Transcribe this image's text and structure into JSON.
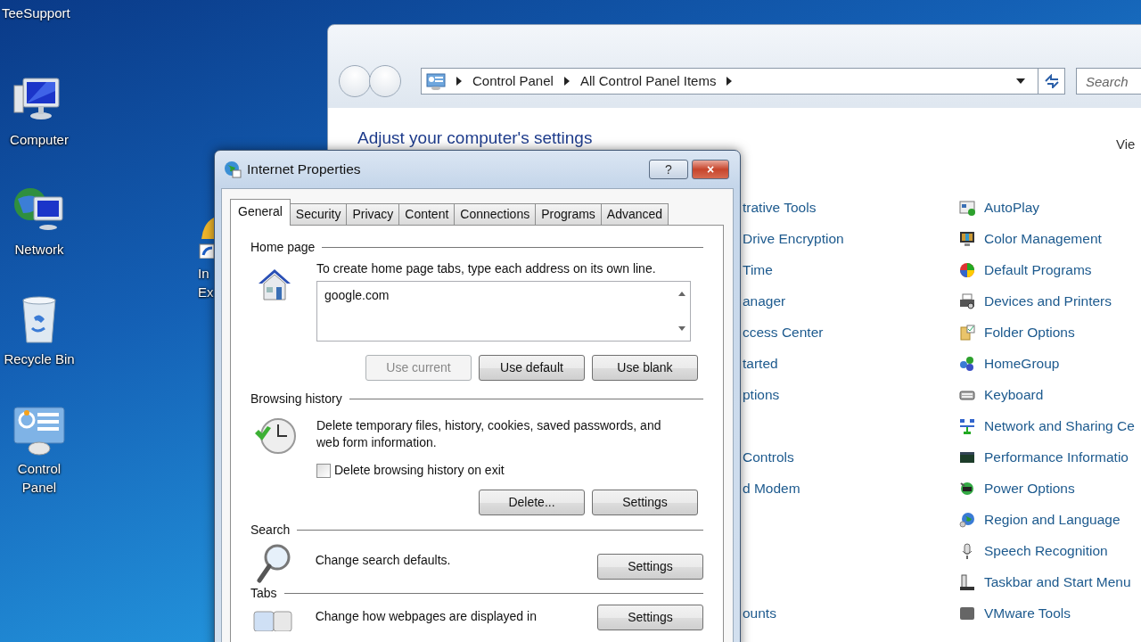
{
  "desktop": {
    "user_label": "TeeSupport",
    "icons": [
      {
        "label": "Computer"
      },
      {
        "label": "Network"
      },
      {
        "label": "Recycle Bin"
      },
      {
        "label": "Control Panel"
      }
    ],
    "partial_icon": {
      "label": "In Ex"
    }
  },
  "control_panel": {
    "breadcrumb": [
      "Control Panel",
      "All Control Panel Items"
    ],
    "search": {
      "placeholder": "Search"
    },
    "heading": "Adjust your computer's settings",
    "view_label": "Vie",
    "rows": [
      {
        "left": "trative Tools",
        "right": "AutoPlay"
      },
      {
        "left": "Drive Encryption",
        "right": "Color Management"
      },
      {
        "left": "Time",
        "right": "Default Programs"
      },
      {
        "left": "anager",
        "right": "Devices and Printers"
      },
      {
        "left": "ccess Center",
        "right": "Folder Options"
      },
      {
        "left": "tarted",
        "right": "HomeGroup"
      },
      {
        "left": "ptions",
        "right": "Keyboard"
      },
      {
        "right": "Network and Sharing Ce"
      },
      {
        "left": "Controls",
        "right": "Performance Informatio"
      },
      {
        "left": "d Modem",
        "right": "Power Options"
      },
      {
        "right": "Region and Language"
      },
      {
        "right": "Speech Recognition"
      },
      {
        "right": "Taskbar and Start Menu"
      },
      {
        "left": "ounts",
        "right": "VMware Tools"
      }
    ]
  },
  "dialog": {
    "title": "Internet Properties",
    "help": "?",
    "close": "×",
    "tabs": [
      {
        "label": "General",
        "selected": true
      },
      {
        "label": "Security",
        "selected": false
      },
      {
        "label": "Privacy",
        "selected": false
      },
      {
        "label": "Content",
        "selected": false
      },
      {
        "label": "Connections",
        "selected": false
      },
      {
        "label": "Programs",
        "selected": false
      },
      {
        "label": "Advanced",
        "selected": false
      }
    ],
    "home_page": {
      "legend": "Home page",
      "hint": "To create home page tabs, type each address on its own line.",
      "value": "google.com",
      "buttons": [
        {
          "label": "Use current",
          "disabled": true
        },
        {
          "label": "Use default",
          "disabled": false
        },
        {
          "label": "Use blank",
          "disabled": false
        }
      ]
    },
    "browsing_history": {
      "legend": "Browsing history",
      "text": "Delete temporary files, history, cookies, saved passwords, and web form information.",
      "checkbox": {
        "label": "Delete browsing history on exit",
        "checked": false
      },
      "buttons": [
        {
          "label": "Delete...",
          "disabled": false
        },
        {
          "label": "Settings",
          "disabled": false
        }
      ]
    },
    "search": {
      "legend": "Search",
      "text": "Change search defaults.",
      "button": "Settings"
    },
    "tabs_section": {
      "legend": "Tabs",
      "text": "Change how webpages are displayed in",
      "button": "Settings"
    }
  }
}
